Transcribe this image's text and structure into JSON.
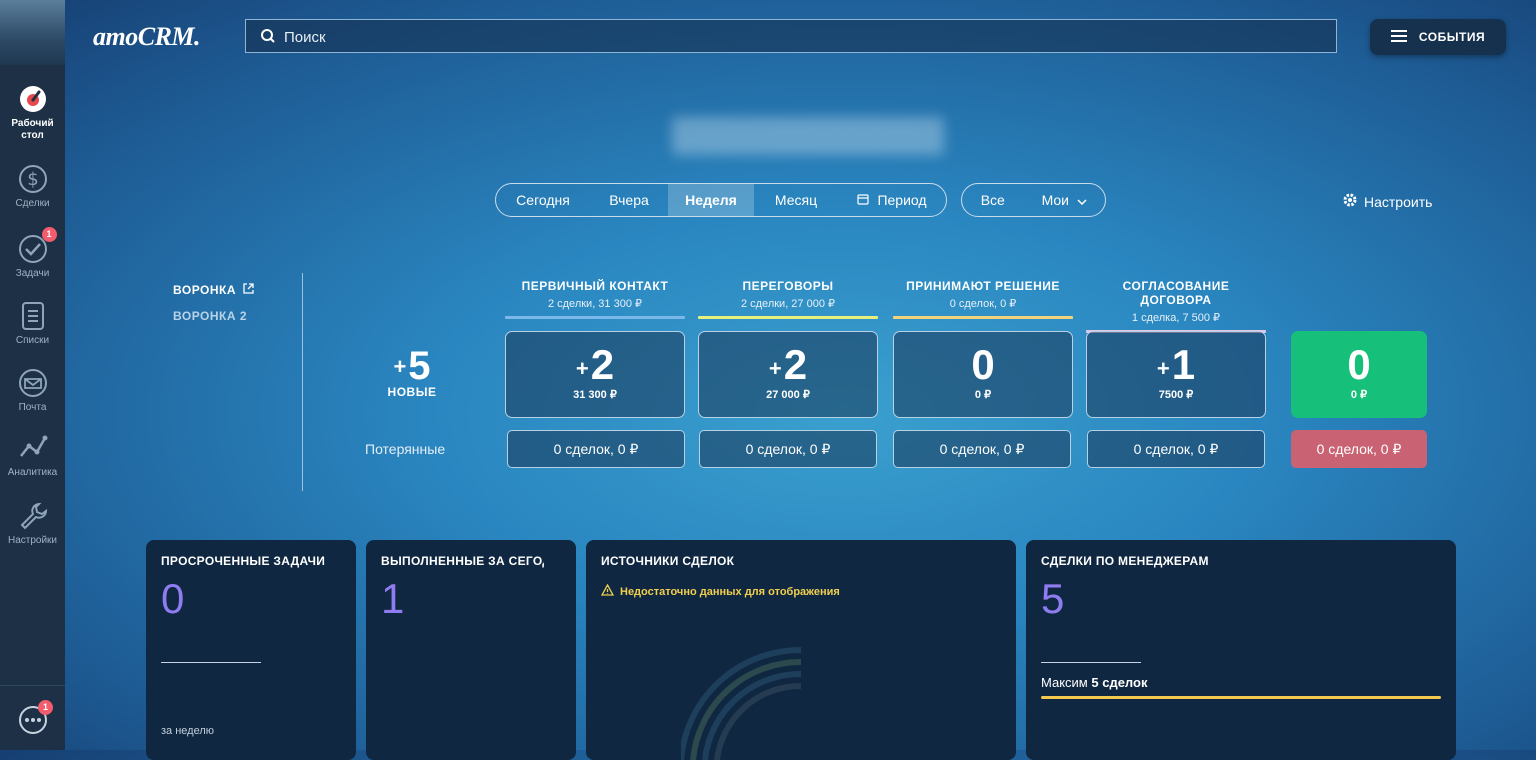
{
  "app": {
    "logo": "amoCRM."
  },
  "sidebar": {
    "items": [
      {
        "label": "Рабочий стол",
        "icon": "dashboard-icon",
        "active": true
      },
      {
        "label": "Сделки",
        "icon": "dollar-icon"
      },
      {
        "label": "Задачи",
        "icon": "check-icon",
        "badge": "1"
      },
      {
        "label": "Списки",
        "icon": "list-icon"
      },
      {
        "label": "Почта",
        "icon": "mail-icon"
      },
      {
        "label": "Аналитика",
        "icon": "analytics-icon"
      },
      {
        "label": "Настройки",
        "icon": "wrench-icon"
      }
    ],
    "chat_badge": "1"
  },
  "header": {
    "search_placeholder": "Поиск",
    "events_label": "СОБЫТИЯ"
  },
  "filters": {
    "periods": [
      "Сегодня",
      "Вчера",
      "Неделя",
      "Месяц",
      "Период"
    ],
    "active_period": "Неделя",
    "scope": [
      "Все",
      "Мои"
    ],
    "settings_label": "Настроить"
  },
  "funnels": [
    "ВОРОНКА",
    "ВОРОНКА 2"
  ],
  "summary": {
    "new_count": "5",
    "new_label": "НОВЫЕ",
    "lost_label": "Потерянные"
  },
  "stages": [
    {
      "name": "ПЕРВИЧНЫЙ КОНТАКТ",
      "sub": "2 сделки, 31 300 ₽",
      "color": "#7ab8ea",
      "count": "2",
      "amount": "31 300 ₽",
      "lost": "0 сделок, 0 ₽",
      "plus": true
    },
    {
      "name": "ПЕРЕГОВОРЫ",
      "sub": "2 сделки, 27 000 ₽",
      "color": "#e6f07a",
      "count": "2",
      "amount": "27 000 ₽",
      "lost": "0 сделок, 0 ₽",
      "plus": true
    },
    {
      "name": "ПРИНИМАЮТ РЕШЕНИЕ",
      "sub": "0 сделок, 0 ₽",
      "color": "#f2d27a",
      "count": "0",
      "amount": "0 ₽",
      "lost": "0 сделок, 0 ₽",
      "plus": false
    },
    {
      "name": "СОГЛАСОВАНИЕ ДОГОВОРА",
      "sub": "1 сделка, 7 500 ₽",
      "color": "#e0c8e8",
      "count": "1",
      "amount": "7500 ₽",
      "lost": "0 сделок, 0 ₽",
      "plus": true
    }
  ],
  "won": {
    "count": "0",
    "amount": "0 ₽",
    "color": "#16c07a"
  },
  "lost_total": {
    "text": "0 сделок, 0 ₽",
    "color": "#c96373"
  },
  "widgets": {
    "overdue": {
      "title": "ПРОСРОЧЕННЫЕ ЗАДАЧИ",
      "value": "0",
      "footer": "за неделю"
    },
    "done_today": {
      "title": "ВЫПОЛНЕННЫЕ ЗА СЕГОДНЯ",
      "value": "1"
    },
    "sources": {
      "title": "ИСТОЧНИКИ СДЕЛОК",
      "warning": "Недостаточно данных для отображения"
    },
    "managers": {
      "title": "СДЕЛКИ ПО МЕНЕДЖЕРАМ",
      "value": "5",
      "manager_name": "Максим",
      "manager_deals": "5 сделок"
    }
  }
}
